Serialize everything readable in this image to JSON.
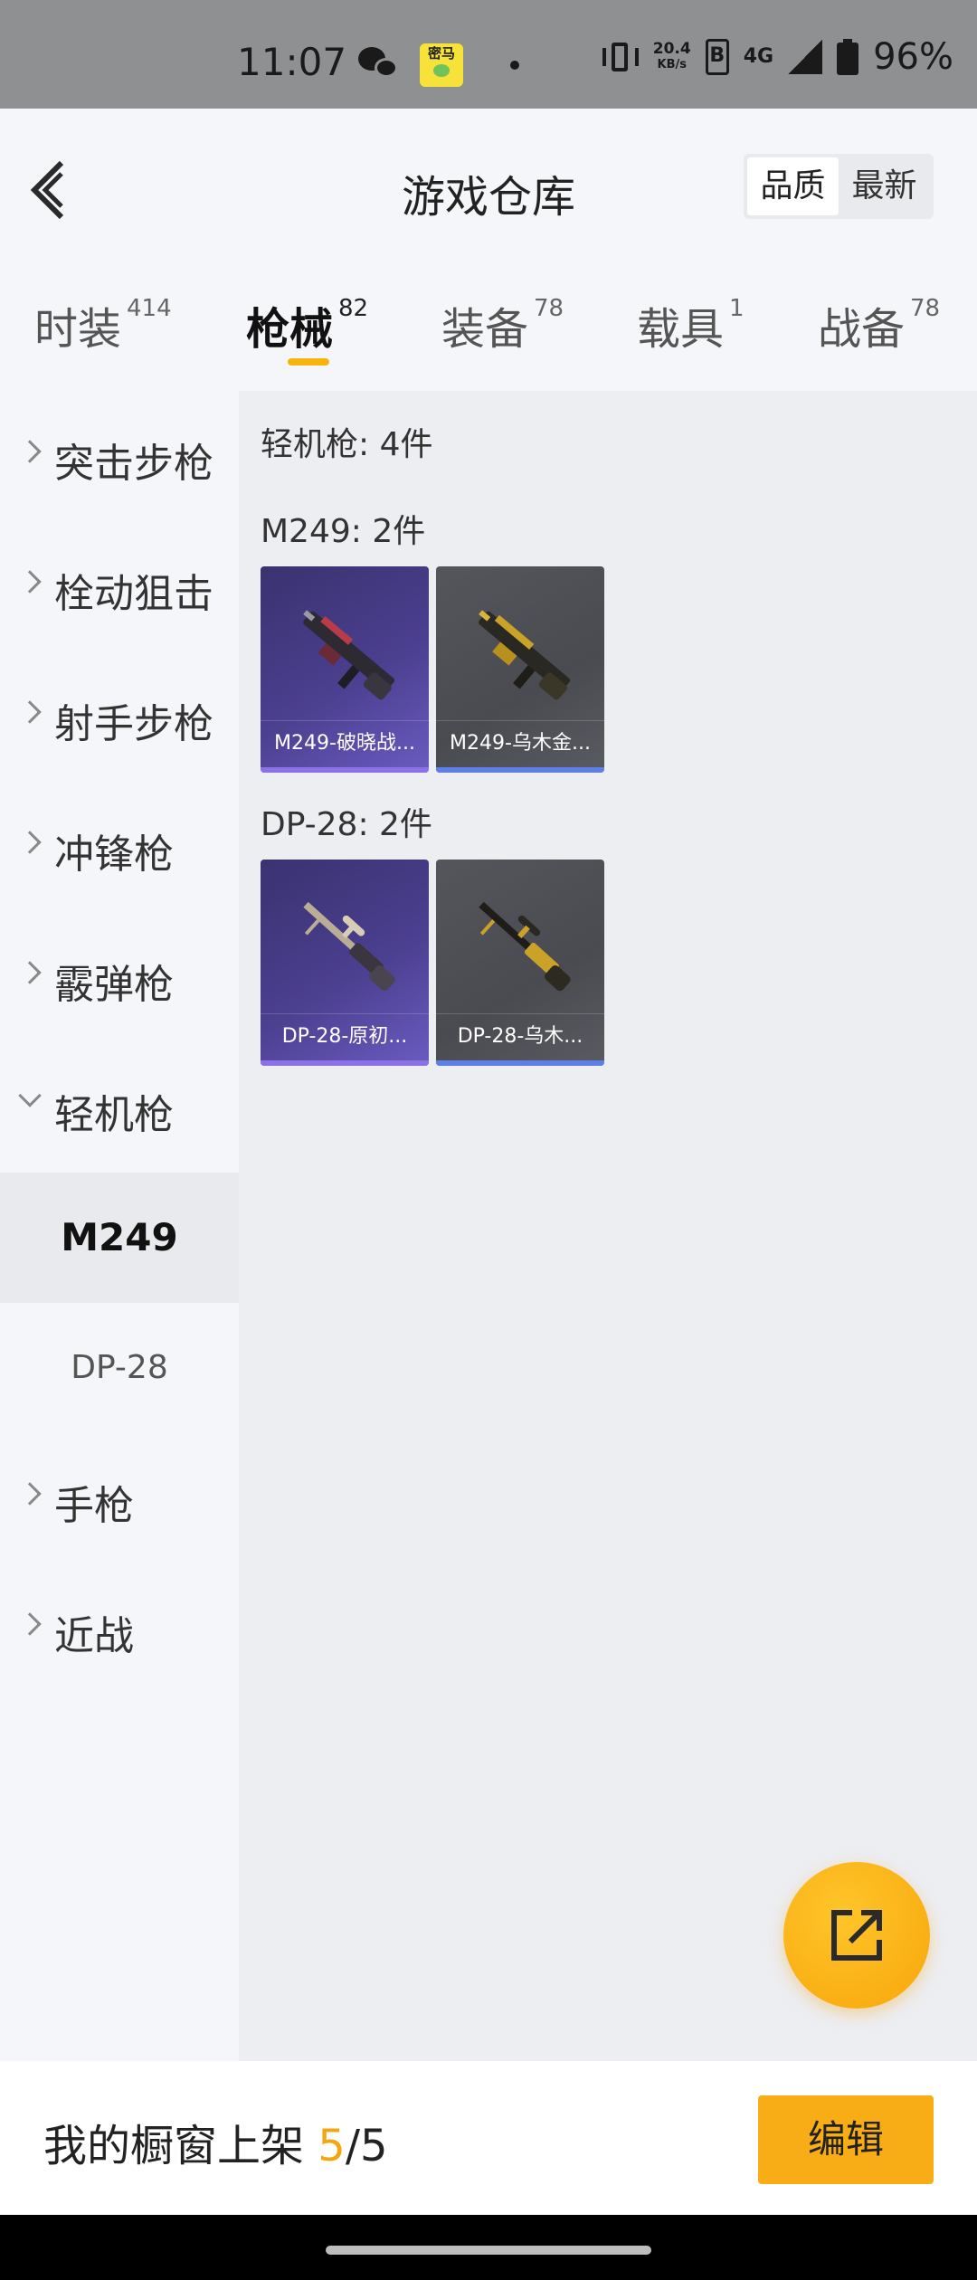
{
  "status_bar": {
    "time": "11:07",
    "app_icon_text": "密马",
    "net_speed_top": "20.4",
    "net_speed_bottom": "KB/s",
    "volte": "B",
    "network": "4G",
    "battery": "96%"
  },
  "header": {
    "title": "游戏仓库",
    "sort_options": [
      "品质",
      "最新"
    ],
    "active_sort": "品质"
  },
  "tabs": [
    {
      "label": "时装",
      "count": "414"
    },
    {
      "label": "枪械",
      "count": "82"
    },
    {
      "label": "装备",
      "count": "78"
    },
    {
      "label": "载具",
      "count": "1"
    },
    {
      "label": "战备",
      "count": "78"
    }
  ],
  "sidebar": {
    "categories": [
      {
        "label": "突击步枪"
      },
      {
        "label": "栓动狙击"
      },
      {
        "label": "射手步枪"
      },
      {
        "label": "冲锋枪"
      },
      {
        "label": "霰弹枪"
      },
      {
        "label": "轻机枪"
      },
      {
        "label": "手枪"
      },
      {
        "label": "近战"
      }
    ],
    "subitems": [
      {
        "label": "M249"
      },
      {
        "label": "DP-28"
      }
    ]
  },
  "content": {
    "category_summary": "轻机枪: 4件",
    "groups": [
      {
        "title": "M249: 2件",
        "items": [
          {
            "name": "M249-破晓战...",
            "rarity": "purple"
          },
          {
            "name": "M249-乌木金...",
            "rarity": "gray"
          }
        ]
      },
      {
        "title": "DP-28: 2件",
        "items": [
          {
            "name": "DP-28-原初...",
            "rarity": "purple"
          },
          {
            "name": "DP-28-乌木...",
            "rarity": "gray"
          }
        ]
      }
    ]
  },
  "bottom_bar": {
    "shelf_label": "我的橱窗上架 ",
    "shelf_current": "5",
    "shelf_total": "/5",
    "edit_label": "编辑"
  },
  "colors": {
    "accent": "#f8ac16",
    "rarity_purple": "#4b3f8f",
    "rarity_gray": "#4a4a51"
  },
  "icons": {
    "back": "chevron-left-icon",
    "fab": "share-external-icon"
  }
}
